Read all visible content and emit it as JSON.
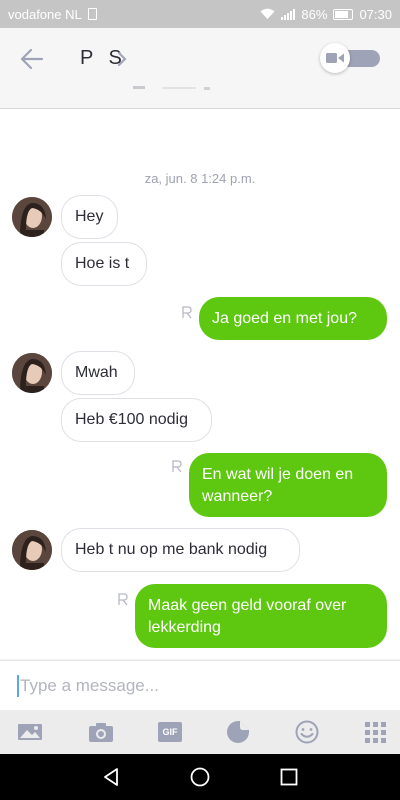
{
  "status_bar": {
    "carrier": "vodafone NL",
    "battery": "86%",
    "time": "07:30"
  },
  "header": {
    "contact_name": "P S",
    "video_toggle_on": false
  },
  "chat": {
    "date": "za, jun. 8 1:24 p.m.",
    "messages": [
      {
        "direction": "in",
        "text": "Hey"
      },
      {
        "direction": "in",
        "text": "Hoe is t"
      },
      {
        "direction": "out",
        "text": "Ja goed en met jou?"
      },
      {
        "direction": "in",
        "text": "Mwah"
      },
      {
        "direction": "in",
        "text": "Heb €100 nodig"
      },
      {
        "direction": "out",
        "text": "En wat wil je doen en wanneer?"
      },
      {
        "direction": "in",
        "text": "Heb t nu op me bank nodig"
      },
      {
        "direction": "out",
        "text": "Maak geen geld vooraf over lekkerding"
      }
    ]
  },
  "composer": {
    "placeholder": "Type a message...",
    "value": ""
  },
  "toolbar": {
    "gif_label": "GIF",
    "icons": [
      "image-icon",
      "camera-icon",
      "gif-icon",
      "sticker-icon",
      "emoji-icon",
      "apps-grid-icon"
    ]
  },
  "colors": {
    "outgoing_bubble": "#5ec710",
    "incoming_border": "#dfe0e6",
    "icon_gray": "#9fa3b7",
    "status_bar": "#c5c5c5"
  }
}
